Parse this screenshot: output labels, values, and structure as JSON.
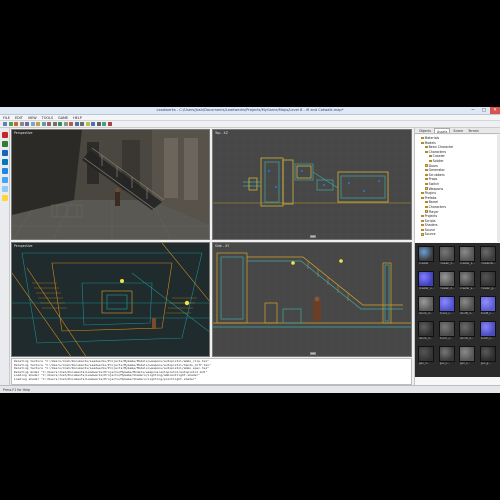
{
  "window": {
    "title": "Leadwerks - C:/Users/Josh/Documents/Leadwerks/Projects/MyGame/Maps/Level 8 - ifl and Catwalk.map*",
    "minimize": "─",
    "maximize": "□",
    "close": "✕"
  },
  "menu": [
    "FILE",
    "EDIT",
    "VIEW",
    "TOOLS",
    "GAME",
    "HELP"
  ],
  "toolbar": {
    "buttons": [
      "#5a7fbf",
      "#4f9b4f",
      "#c46a2b",
      "#888888",
      "#6b6b9c",
      "#8aa0c0",
      "#c0a050",
      "#5aa0a0",
      "#a05a5a",
      "#707070",
      "#3c8c5a",
      "#909090",
      "#b06040",
      "#4f6fa0",
      "#6a6a6a",
      "#c0c040",
      "#5070b0",
      "#606060",
      "#40a080",
      "#b04040"
    ]
  },
  "left_tools": {
    "items": [
      {
        "icon": "select-icon",
        "color": "#c62828"
      },
      {
        "icon": "box-icon",
        "color": "#2e7d32"
      },
      {
        "icon": "wedge-icon",
        "color": "#1565c0"
      },
      {
        "icon": "cylinder-icon",
        "color": "#0277bd"
      },
      {
        "icon": "sphere-icon",
        "color": "#1e88e5"
      },
      {
        "icon": "cone-icon",
        "color": "#42a5f5"
      },
      {
        "icon": "face-icon",
        "color": "#90caf9"
      },
      {
        "icon": "light-icon",
        "color": "#fdd835"
      }
    ]
  },
  "viewports": {
    "perspective": "Perspective",
    "top": "Top - XZ",
    "perspective2": "Perspective",
    "side": "Side - XY"
  },
  "console": {
    "lines": [
      "Deleting texture \"C:/Users/Josh/Documents/Leadwerks/Projects/MyGame/Models/weapons/autopistol/ammo_clip.tex\"",
      "Deleting texture \"C:/Users/Josh/Documents/Leadwerks/Projects/MyGame/Models/weapons/autopistol/hands_diff.tex\"",
      "Deleting texture \"C:/Users/Josh/Documents/Leadwerks/Projects/MyGame/Models/weapons/autopistol/ammo_spec.tex\"",
      "Deleting model \"C:/Users/Josh/Documents/Leadwerks/Projects/MyGame/Models/weapons/autopistol/autopistol.mdl\"",
      "Loading shader \"C:/Users/Josh/Documents/Leadwerks/Projects/MyGame/Shaders/Lighting/ambientlight.shader\"",
      "Loading shader \"C:/Users/Josh/Documents/Leadwerks/Projects/MyGame/Shaders/Lighting/pointlight.shader\""
    ]
  },
  "right_panel": {
    "tabs": [
      "Objects",
      "Assets",
      "Scene",
      "Terrain"
    ],
    "active_tab": "Assets",
    "tree": [
      {
        "label": "Materials",
        "depth": 1
      },
      {
        "label": "Models",
        "depth": 1
      },
      {
        "label": "Bean Character",
        "depth": 2
      },
      {
        "label": "Characters",
        "depth": 2
      },
      {
        "label": "Crawler",
        "depth": 3
      },
      {
        "label": "Soldier",
        "depth": 3
      },
      {
        "label": "Doors",
        "depth": 2
      },
      {
        "label": "Generator",
        "depth": 2
      },
      {
        "label": "Scrubbers",
        "depth": 2
      },
      {
        "label": "Props",
        "depth": 2
      },
      {
        "label": "Switch",
        "depth": 2
      },
      {
        "label": "Weapons",
        "depth": 2
      },
      {
        "label": "Plugins",
        "depth": 1
      },
      {
        "label": "Prefabs",
        "depth": 1
      },
      {
        "label": "Barrel",
        "depth": 2
      },
      {
        "label": "Characters",
        "depth": 2
      },
      {
        "label": "Player",
        "depth": 2
      },
      {
        "label": "Projects",
        "depth": 1
      },
      {
        "label": "Scripts",
        "depth": 1
      },
      {
        "label": "Shaders",
        "depth": 1
      },
      {
        "label": "Sound",
        "depth": 1
      },
      {
        "label": "Source",
        "depth": 1
      }
    ],
    "thumbnails": [
      {
        "caption": "crawler",
        "color": "#3a3a3a",
        "accent": "#6aa0d8"
      },
      {
        "caption": "crawler_d...",
        "color": "#4a4a4a",
        "accent": "#777777"
      },
      {
        "caption": "crawler_s...",
        "color": "#555555",
        "accent": "#8a8a8a"
      },
      {
        "caption": "crawlerdo...",
        "color": "#3b3b3b",
        "accent": "#6a6a6a"
      },
      {
        "caption": "crawler_n...",
        "color": "#4040b8",
        "accent": "#8080ff"
      },
      {
        "caption": "crawler_d...",
        "color": "#555555",
        "accent": "#999999"
      },
      {
        "caption": "crawler_s...",
        "color": "#444444",
        "accent": "#888888"
      },
      {
        "caption": "crawler_g...",
        "color": "#333333",
        "accent": "#555555"
      },
      {
        "caption": "doorA_d...",
        "color": "#5a5a5a",
        "accent": "#9a9a9a"
      },
      {
        "caption": "doorA_n...",
        "color": "#5050c8",
        "accent": "#8a8aff"
      },
      {
        "caption": "doorB_d...",
        "color": "#4e4e4e",
        "accent": "#8a8a8a"
      },
      {
        "caption": "doorB_n...",
        "color": "#5a5ad0",
        "accent": "#9090ff"
      },
      {
        "caption": "doorC_d...",
        "color": "#303030",
        "accent": "#606060"
      },
      {
        "caption": "doorC_s...",
        "color": "#4a4a4a",
        "accent": "#7a7a7a"
      },
      {
        "caption": "doorD_d...",
        "color": "#3c3c3c",
        "accent": "#6c6c6c"
      },
      {
        "caption": "doorD_n...",
        "color": "#4b4bbd",
        "accent": "#8686f8"
      },
      {
        "caption": "gen_d...",
        "color": "#333333",
        "accent": "#555555"
      },
      {
        "caption": "gen_n...",
        "color": "#3a3a3a",
        "accent": "#777777"
      },
      {
        "caption": "gen_s...",
        "color": "#555555",
        "accent": "#8a8a8a"
      },
      {
        "caption": "gen_g...",
        "color": "#2c2c2c",
        "accent": "#5a5a5a"
      }
    ]
  },
  "status": {
    "text": "Press F1 for Help"
  }
}
